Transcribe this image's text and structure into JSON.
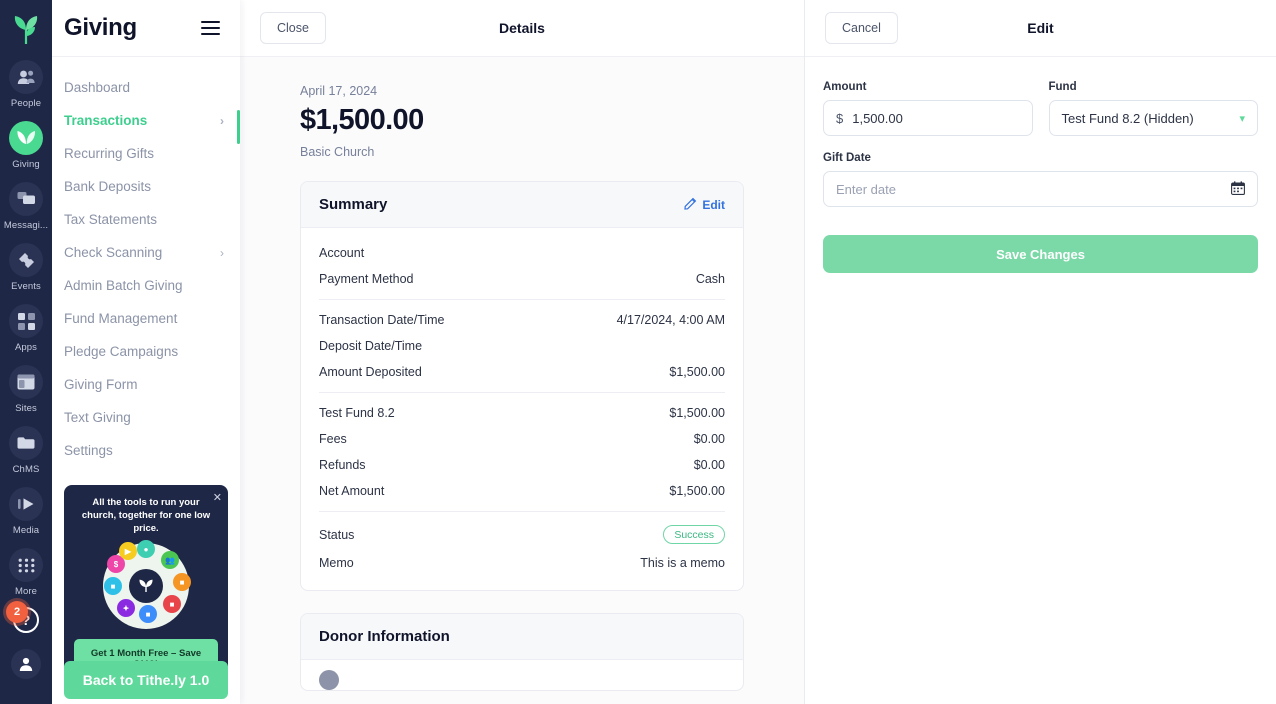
{
  "rail": {
    "logo_icon": "tithely-leaf-logo",
    "items": [
      {
        "label": "People",
        "icon": "people-icon",
        "active": false
      },
      {
        "label": "Giving",
        "icon": "leaf-icon",
        "active": true
      },
      {
        "label": "Messagi...",
        "icon": "chat-bubbles-icon",
        "active": false
      },
      {
        "label": "Events",
        "icon": "ticket-icon",
        "active": false
      },
      {
        "label": "Apps",
        "icon": "grid-squares-icon",
        "active": false
      },
      {
        "label": "Sites",
        "icon": "layout-icon",
        "active": false
      },
      {
        "label": "ChMS",
        "icon": "folder-icon",
        "active": false
      },
      {
        "label": "Media",
        "icon": "play-icon",
        "active": false
      },
      {
        "label": "More",
        "icon": "dots-grid-icon",
        "active": false
      }
    ],
    "help_badge_count": "2",
    "help_glyph": "?"
  },
  "nav": {
    "title": "Giving",
    "menu_icon": "hamburger-icon",
    "items": [
      {
        "label": "Dashboard",
        "chevron": false,
        "active": false
      },
      {
        "label": "Transactions",
        "chevron": true,
        "active": true
      },
      {
        "label": "Recurring Gifts",
        "chevron": false,
        "active": false
      },
      {
        "label": "Bank Deposits",
        "chevron": false,
        "active": false
      },
      {
        "label": "Tax Statements",
        "chevron": false,
        "active": false
      },
      {
        "label": "Check Scanning",
        "chevron": true,
        "active": false
      },
      {
        "label": "Admin Batch Giving",
        "chevron": false,
        "active": false
      },
      {
        "label": "Fund Management",
        "chevron": false,
        "active": false
      },
      {
        "label": "Pledge Campaigns",
        "chevron": false,
        "active": false
      },
      {
        "label": "Giving Form",
        "chevron": false,
        "active": false
      },
      {
        "label": "Text Giving",
        "chevron": false,
        "active": false
      },
      {
        "label": "Settings",
        "chevron": false,
        "active": false
      }
    ],
    "promo": {
      "headline": "All the tools to run your church, together for one low price.",
      "cta": "Get 1 Month Free – Save $119!",
      "close_icon": "close-icon"
    },
    "back_button": "Back to Tithe.ly 1.0"
  },
  "details": {
    "close_label": "Close",
    "title": "Details",
    "date": "April 17, 2024",
    "amount": "$1,500.00",
    "organization": "Basic Church",
    "summary": {
      "title": "Summary",
      "edit_label": "Edit",
      "edit_icon": "pencil-icon",
      "group1": [
        {
          "key": "Account",
          "value": ""
        },
        {
          "key": "Payment Method",
          "value": "Cash"
        }
      ],
      "group2": [
        {
          "key": "Transaction Date/Time",
          "value": "4/17/2024, 4:00 AM"
        },
        {
          "key": "Deposit Date/Time",
          "value": ""
        },
        {
          "key": "Amount Deposited",
          "value": "$1,500.00"
        }
      ],
      "group3": [
        {
          "key": "Test Fund 8.2",
          "value": "$1,500.00"
        },
        {
          "key": "Fees",
          "value": "$0.00"
        },
        {
          "key": "Refunds",
          "value": "$0.00"
        },
        {
          "key": "Net Amount",
          "value": "$1,500.00"
        }
      ],
      "status_key": "Status",
      "status_value": "Success",
      "memo_key": "Memo",
      "memo_value": "This is a memo"
    },
    "donor": {
      "title": "Donor Information"
    }
  },
  "edit": {
    "cancel_label": "Cancel",
    "title": "Edit",
    "amount_label": "Amount",
    "amount_prefix": "$",
    "amount_value": "1,500.00",
    "fund_label": "Fund",
    "fund_value": "Test Fund 8.2 (Hidden)",
    "fund_chevron_icon": "chevron-down-icon",
    "gift_date_label": "Gift Date",
    "gift_date_placeholder": "Enter date",
    "calendar_icon": "calendar-icon",
    "save_label": "Save Changes"
  },
  "colors": {
    "brand_green": "#3ecf8e",
    "navy": "#1e2746",
    "link_blue": "#3272e0",
    "success": "#3cb882",
    "badge_orange": "#f1613f"
  }
}
